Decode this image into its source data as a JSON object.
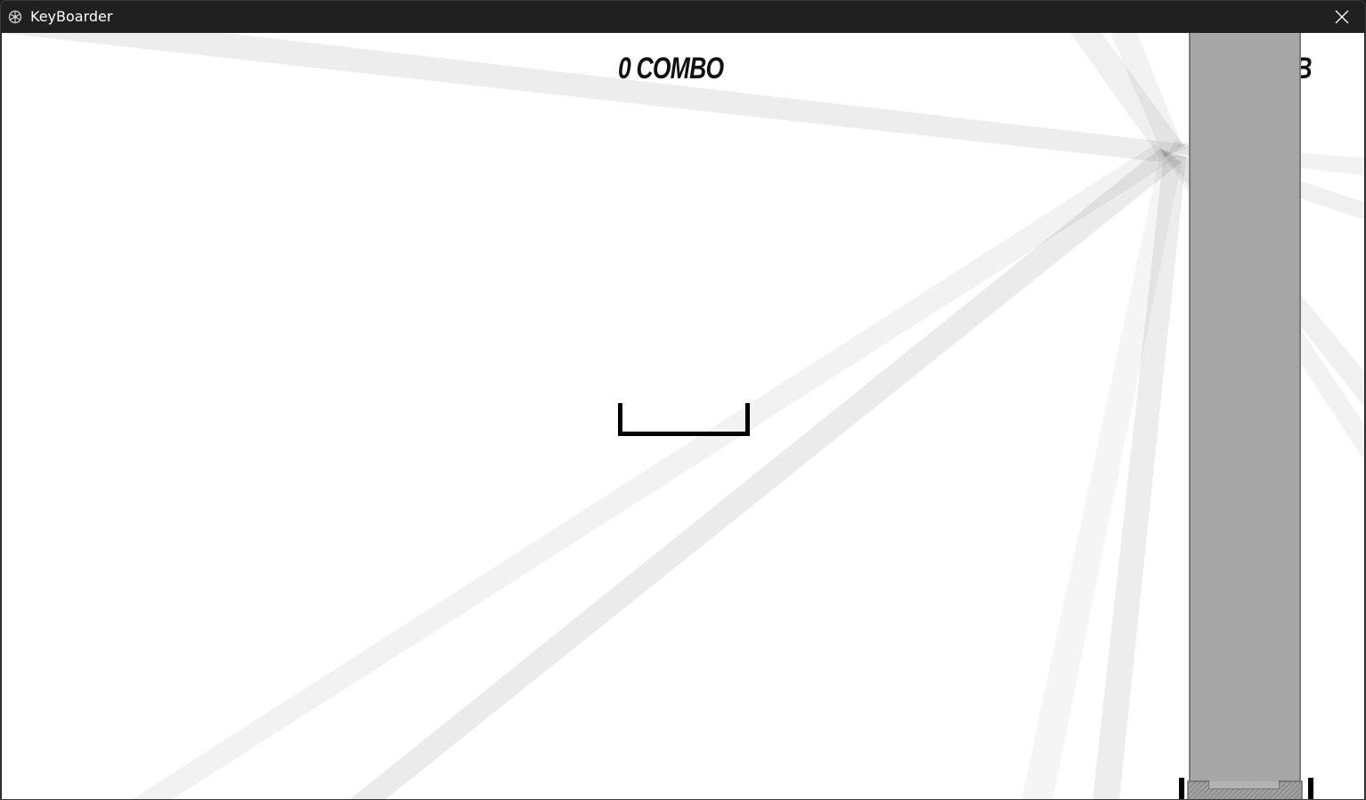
{
  "window": {
    "title": "KeyBoarder",
    "app_icon": "keyboarder-app-icon",
    "close_icon": "close-icon"
  },
  "hud": {
    "combo": "0 COMBO",
    "score": "0KB"
  },
  "game": {
    "background_color": "#ffffff",
    "ray_color": "#dcdcdc",
    "column_color": "#a6a6a6",
    "cursor_color": "#000000"
  }
}
